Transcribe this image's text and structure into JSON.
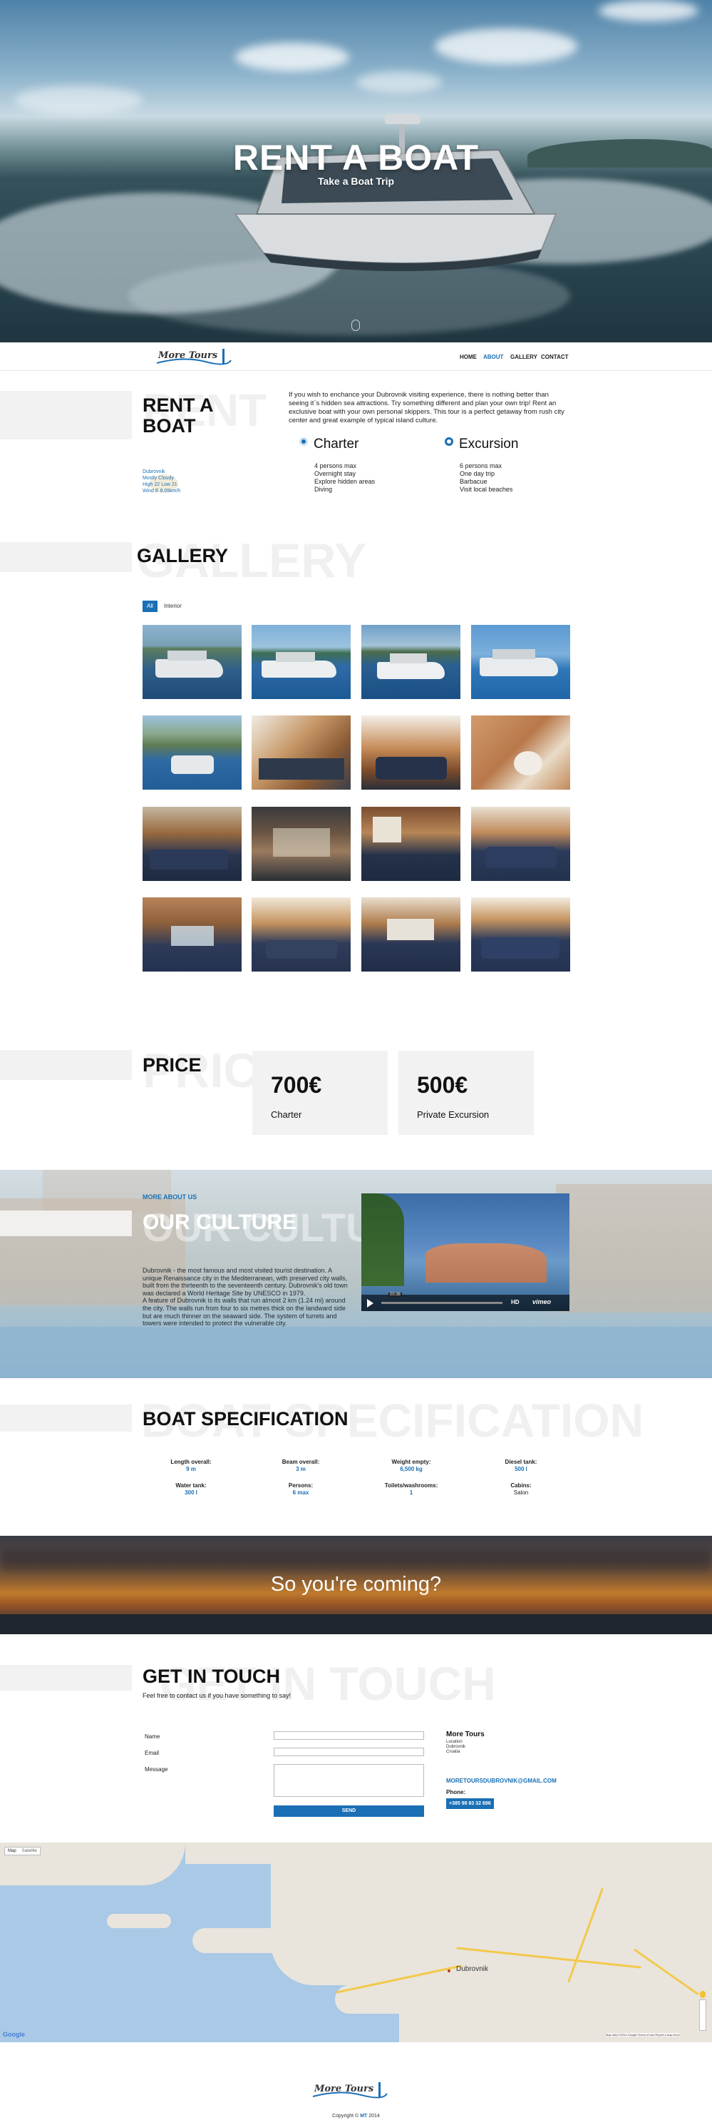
{
  "hero": {
    "title": "RENT A BOAT",
    "subtitle": "Take a Boat Trip"
  },
  "nav": {
    "logo_text": "More Tours",
    "links": [
      "HOME",
      "ABOUT",
      "GALLERY",
      "CONTACT"
    ],
    "active": "ABOUT"
  },
  "about": {
    "ghost": "RENT",
    "title_line1": "RENT A",
    "title_line2": "BOAT",
    "weather_city": "Dubrovnik",
    "weather_cond": "Mostly Cloudy",
    "weather_hilo": "High 22 Low 21",
    "weather_wind": "Wind E 8.05km/h",
    "intro": "If you wish to enchance your Dubrovnik visiting experience, there is nothing better than seeing it`s hidden sea attractions. Try something different and plan your own trip! Rent an exclusive boat with your own personal skippers. This tour is a perfect getaway from rush city center and great example of typical island culture.",
    "charter": {
      "title": "Charter",
      "items": [
        "4 persons max",
        "Overnight stay",
        "Explore hidden areas",
        "Diving"
      ]
    },
    "excursion": {
      "title": "Excursion",
      "items": [
        "6 persons max",
        "One day trip",
        "Barbacue",
        "Visit local beaches"
      ]
    }
  },
  "gallery": {
    "ghost": "GALLERY",
    "title": "GALLERY",
    "filters": [
      "All",
      "Interior"
    ],
    "active_filter": "All"
  },
  "price": {
    "ghost": "PRICE",
    "title": "PRICE",
    "cards": [
      {
        "amount": "700€",
        "label": "Charter"
      },
      {
        "amount": "500€",
        "label": "Private Excursion"
      }
    ]
  },
  "culture": {
    "kicker": "MORE ABOUT US",
    "title": "OUR CULTURE",
    "ghost": "OUR CULTURE",
    "text": "Dubrovnik - the most famous and most visited tourist destination. A unique Renaissance city in the Mediterranean, with preserved city walls, built from the thirteenth to the seventeenth century. Dubrovnik's old town was declared a World Heritage Site by UNESCO in 1979.\nA feature of Dubrovnik is its walls that run almost 2 km (1.24 mi) around the city. The walls run from four to six metres thick on the landward side but are much thinner on the seaward side. The system of turrets and towers were intended to protect the vulnerable city.",
    "video_time": "00:36",
    "video_hd": "HD",
    "video_brand": "vimeo"
  },
  "spec": {
    "ghost": "BOAT SPECIFICATION",
    "title": "BOAT SPECIFICATION",
    "items": [
      {
        "k": "Length overall:",
        "v": "9 m"
      },
      {
        "k": "Beam overall:",
        "v": "3 m"
      },
      {
        "k": "Weight empty:",
        "v": "6,500 kg"
      },
      {
        "k": "Diesel tank:",
        "v": "500 l"
      },
      {
        "k": "Water tank:",
        "v": "300 l"
      },
      {
        "k": "Persons:",
        "v": "6 max"
      },
      {
        "k": "Toilets/washrooms:",
        "v": "1"
      },
      {
        "k": "Cabins:",
        "v": "Salon"
      }
    ]
  },
  "coming": {
    "text": "So you're coming?"
  },
  "contact": {
    "ghost": "GET IN TOUCH",
    "title": "GET IN TOUCH",
    "subtitle": "Feel free to contact us if you have something to say!",
    "labels": {
      "name": "Name",
      "email": "Email",
      "message": "Message"
    },
    "send": "SEND",
    "company": "More Tours",
    "location_label": "Location",
    "city": "Dubrovnik",
    "country": "Croatia",
    "email": "MORETOURSDUBROVNIK@GMAIL.COM",
    "phone_label": "Phone:",
    "phone": "+385 99 83 32 696"
  },
  "map": {
    "tabs": [
      "Map",
      "Satellite"
    ],
    "city": "Dubrovnik",
    "google": "Google",
    "terms": "Map data ©2014 Google   Terms of Use   Report a map error"
  },
  "footer": {
    "copyright": "Copyright © ",
    "brand": "MT",
    "year": " 2014"
  },
  "colors": {
    "accent": "#1a6fb5",
    "ghost": "#f0f0f0",
    "panel": "#f2f2f2"
  }
}
